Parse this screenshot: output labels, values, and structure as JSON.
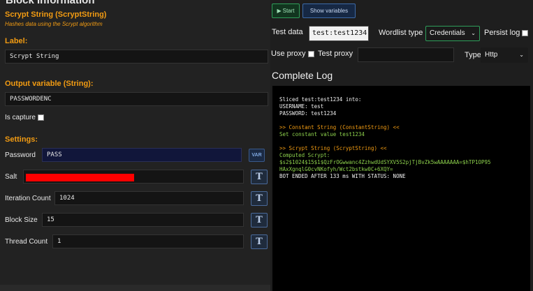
{
  "block": {
    "heading": "Block Information",
    "title": "Scrypt String (ScryptString)",
    "description": "Hashes data using the Scrypt algorithm"
  },
  "label": {
    "heading": "Label:",
    "value": "Scrypt String"
  },
  "output": {
    "heading": "Output variable (String):",
    "value": "PASSWORDENC",
    "is_capture_label": "Is capture",
    "is_capture_checked": false
  },
  "settings": {
    "heading": "Settings:",
    "var_label": "VAR",
    "t_label": "T",
    "password": {
      "name": "Password",
      "value": "PASS"
    },
    "salt": {
      "name": "Salt",
      "value": ""
    },
    "iteration_count": {
      "name": "Iteration Count",
      "value": "1024"
    },
    "block_size": {
      "name": "Block Size",
      "value": "15"
    },
    "thread_count": {
      "name": "Thread Count",
      "value": "1"
    }
  },
  "toolbar": {
    "start_icon": "play-icon",
    "start_label": "Start",
    "show_variables_label": "Show variables"
  },
  "test": {
    "test_data_label": "Test data",
    "test_data_value": "test:test1234",
    "wordlist_type_label": "Wordlist type",
    "wordlist_type_value": "Credentials",
    "persist_log_label": "Persist log",
    "use_proxy_label": "Use proxy",
    "test_proxy_label": "Test proxy",
    "test_proxy_value": "",
    "type_label": "Type",
    "type_value": "Http"
  },
  "log": {
    "title": "Complete Log",
    "lines": [
      {
        "text": "Sliced test:test1234 into:",
        "color": "white"
      },
      {
        "text": "USERNAME: test",
        "color": "white"
      },
      {
        "text": "PASSWORD: test1234",
        "color": "white"
      },
      {
        "text": "",
        "color": "gap"
      },
      {
        "text": ">> Constant String (ConstantString) <<",
        "color": "orange"
      },
      {
        "text": "Set constant value test1234",
        "color": "green"
      },
      {
        "text": "",
        "color": "gap"
      },
      {
        "text": ">> Scrypt String (ScryptString) <<",
        "color": "orange"
      },
      {
        "text": "Computed Scrypt:",
        "color": "green"
      },
      {
        "text": "$s2$1024$15$1$QzFrOGwwanc4ZzhwdUdSYXV5S2pjTjBvZk5wAAAAAAA=$hTP1OP95",
        "color": "green"
      },
      {
        "text": "HAxXgnqlG0cvNKofyh/Wct2bstkw0C+6XQY=",
        "color": "green"
      },
      {
        "text": "BOT ENDED AFTER 133 ms WITH STATUS: NONE",
        "color": "white"
      }
    ]
  },
  "colors": {
    "accent_orange": "#f39c12",
    "log_green": "#8dd14c",
    "start_green": "#2f9e5a",
    "redaction": "#ff0000"
  }
}
